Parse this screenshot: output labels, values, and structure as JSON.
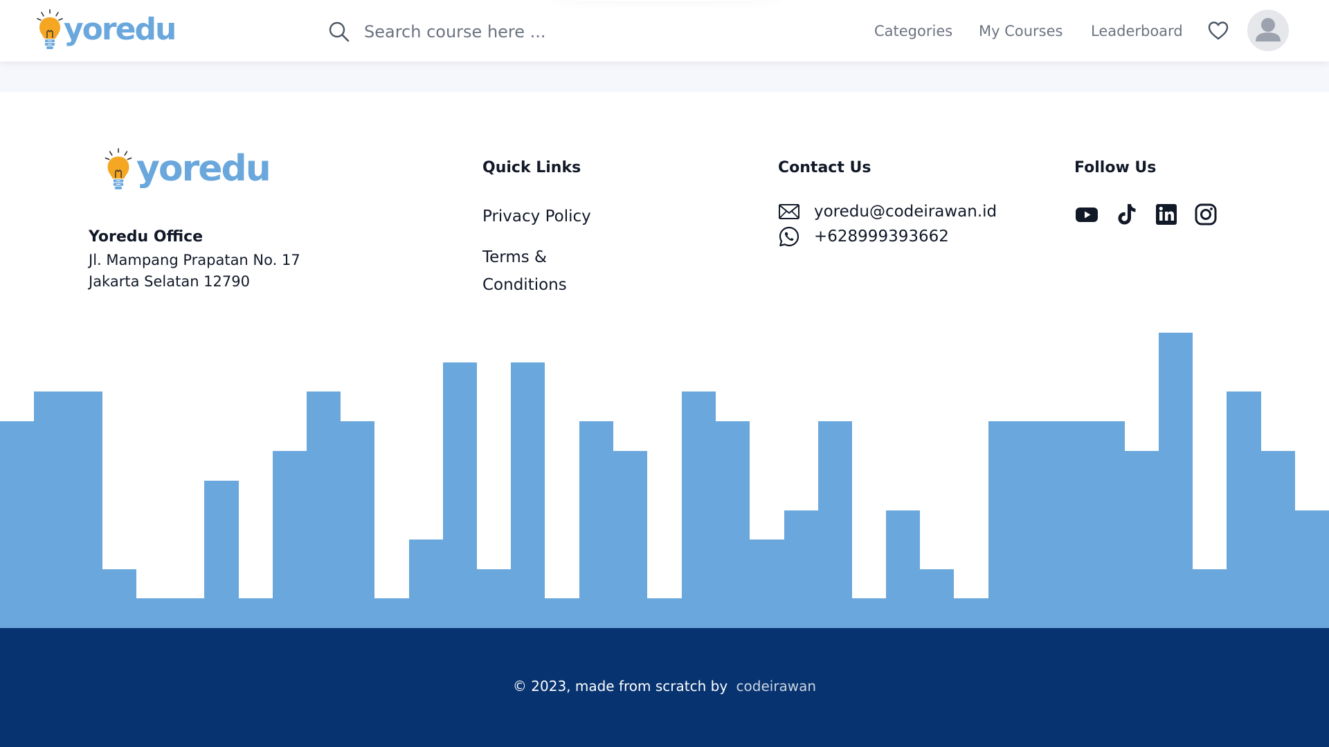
{
  "brand": {
    "name": "yoredu",
    "colors": {
      "logo_text": "#6aa7dc",
      "bulb": "#f5a623",
      "skyline": "#6aa7dc",
      "footer_bar": "#073370"
    }
  },
  "header": {
    "search": {
      "placeholder": "Search course here ...",
      "icon": "search-icon"
    },
    "nav": [
      {
        "label": "Categories"
      },
      {
        "label": "My Courses"
      },
      {
        "label": "Leaderboard"
      }
    ],
    "wishlist_icon": "heart-icon",
    "avatar_icon": "user-avatar-icon"
  },
  "footer": {
    "office": {
      "title": "Yoredu Office",
      "address_line1": "Jl. Mampang Prapatan No. 17",
      "address_line2": "Jakarta Selatan 12790"
    },
    "quick_links": {
      "title": "Quick Links",
      "items": [
        {
          "label": "Privacy Policy"
        },
        {
          "label_line1": "Terms &",
          "label_line2": "Conditions"
        }
      ]
    },
    "contact": {
      "title": "Contact Us",
      "email": "yoredu@codeirawan.id",
      "phone": "+628999393662",
      "email_icon": "envelope-icon",
      "phone_icon": "whatsapp-icon"
    },
    "follow": {
      "title": "Follow Us",
      "icons": [
        "youtube-icon",
        "tiktok-icon",
        "linkedin-icon",
        "instagram-icon"
      ]
    },
    "copyright": {
      "text": "© 2023, made from scratch by",
      "author": "codeirawan"
    }
  }
}
